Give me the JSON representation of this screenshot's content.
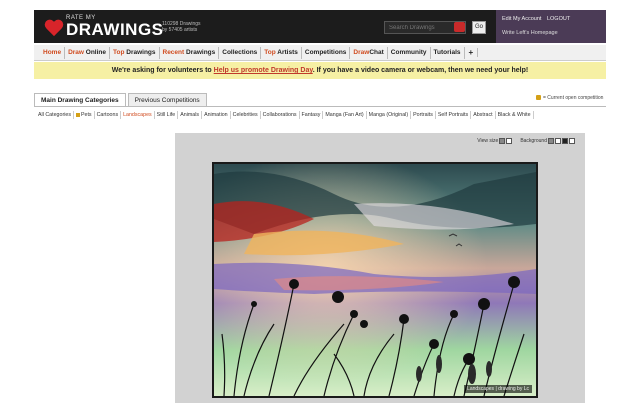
{
  "header": {
    "logo_small": "RATE MY",
    "logo_big": "DRAWINGS",
    "stats_line1": "110298 Drawings",
    "stats_line2": "by 57405 artists",
    "search_placeholder": "Search Drawings",
    "go_label": "Go",
    "account": {
      "edit": "Edit My Account",
      "logout": "LOGOUT",
      "wishlist": "Write Left's Homepage"
    }
  },
  "nav": {
    "items": [
      {
        "prefix": "Home",
        "rest": ""
      },
      {
        "prefix": "Draw",
        "rest": " Online"
      },
      {
        "prefix": "Top",
        "rest": " Drawings"
      },
      {
        "prefix": "Recent",
        "rest": " Drawings"
      },
      {
        "prefix": "",
        "rest": "Collections"
      },
      {
        "prefix": "Top",
        "rest": " Artists"
      },
      {
        "prefix": "",
        "rest": "Competitions"
      },
      {
        "prefix": "Draw",
        "rest": "Chat"
      },
      {
        "prefix": "",
        "rest": "Community"
      },
      {
        "prefix": "",
        "rest": "Tutorials"
      }
    ],
    "plus": "+"
  },
  "banner": {
    "before": "We're asking for volunteers to ",
    "link": "Help us promote Drawing Day",
    "after": ". If you have a video camera or webcam, then we need your help!"
  },
  "tabs": {
    "main": "Main Drawing Categories",
    "previous": "Previous Competitions",
    "competitor_note": "= Current open competition"
  },
  "categories": [
    "All Categories",
    "Pets",
    "Cartoons",
    "Landscapes",
    "Still Life",
    "Animals",
    "Animation",
    "Celebrities",
    "Collaborations",
    "Fantasy",
    "Manga (Fan Art)",
    "Manga (Original)",
    "Portraits",
    "Self Portraits",
    "Abstract",
    "Black & White"
  ],
  "active_category": "Landscapes",
  "viewer": {
    "view_size_label": "View size",
    "background_label": "Background",
    "caption": "Landscapes | drawing by Lc"
  },
  "colors": {
    "header_bg": "#1c1c1c",
    "accent": "#d04b1f",
    "banner_bg": "#f6f0a4",
    "account_bg": "#4b3b56"
  }
}
